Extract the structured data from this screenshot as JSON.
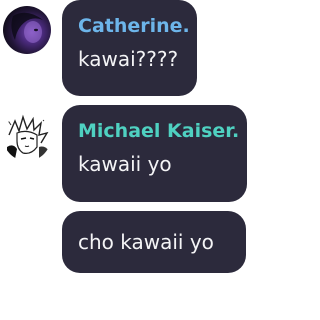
{
  "messages": [
    {
      "sender": "Catherine.",
      "sender_color": "#6db5ea",
      "text": "kawai????",
      "avatar": "dark-purple-portrait-avatar"
    },
    {
      "sender": "Michael Kaiser.",
      "sender_color": "#4fd1c1",
      "text": "kawaii yo",
      "avatar": "manga-sketch-avatar"
    },
    {
      "text": "cho kawaii yo"
    }
  ],
  "colors": {
    "bubble_bg": "#2c2a3c",
    "message_text": "#f4f4f6",
    "page_bg": "#ffffff"
  }
}
